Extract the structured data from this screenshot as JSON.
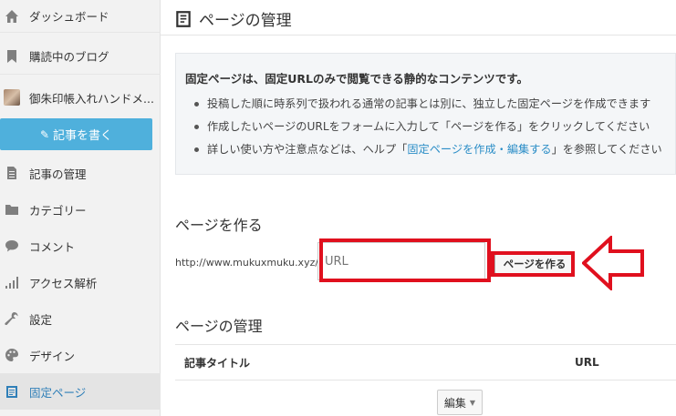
{
  "sidebar": {
    "items": [
      {
        "label": "ダッシュボード",
        "icon": "home-icon"
      },
      {
        "label": "購読中のブログ",
        "icon": "bookmark-icon"
      },
      {
        "label": "御朱印帳入れハンドメ...",
        "icon": "blog-thumbnail"
      },
      {
        "label": "記事の管理",
        "icon": "document-icon"
      },
      {
        "label": "カテゴリー",
        "icon": "folder-icon"
      },
      {
        "label": "コメント",
        "icon": "comment-icon"
      },
      {
        "label": "アクセス解析",
        "icon": "bar-chart-icon"
      },
      {
        "label": "設定",
        "icon": "wrench-icon"
      },
      {
        "label": "デザイン",
        "icon": "palette-icon"
      },
      {
        "label": "固定ページ",
        "icon": "pages-icon"
      }
    ],
    "write_button": "記事を書く",
    "active_color": "#2f7fb8",
    "write_button_color": "#4fb0dc"
  },
  "header": {
    "title": "ページの管理"
  },
  "info": {
    "title": "固定ページは、固定URLのみで閲覧できる静的なコンテンツです。",
    "bullet1": "投稿した順に時系列で扱われる通常の記事とは別に、独立した固定ページを作成できます",
    "bullet2": "作成したいページのURLをフォームに入力して「ページを作る」をクリックしてください",
    "bullet3_pre": "詳しい使い方や注意点などは、ヘルプ「",
    "bullet3_link": "固定ページを作成・編集する",
    "bullet3_post": "」を参照してください"
  },
  "create": {
    "section_title": "ページを作る",
    "url_prefix": "http://www.mukuxmuku.xyz/",
    "input_placeholder": "URL",
    "input_value": "",
    "button_label": "ページを作る",
    "highlight_color": "#e0101e"
  },
  "manage": {
    "section_title": "ページの管理",
    "columns": [
      "記事タイトル",
      "URL"
    ],
    "edit_button": "編集"
  }
}
